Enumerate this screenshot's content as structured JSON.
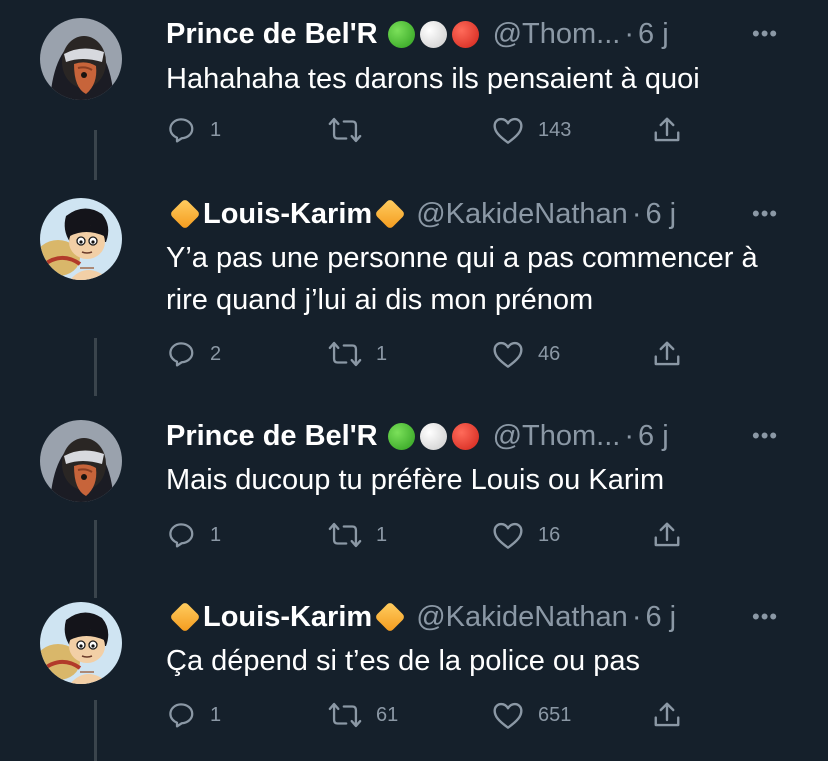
{
  "colors": {
    "background": "#15202b",
    "thread_line": "#3a444c",
    "secondary_text": "#8b98a5",
    "primary_text": "#ffffff"
  },
  "tweets": [
    {
      "author": "Prince de Bel'R",
      "name_decor": [
        "green-circle",
        "white-circle",
        "red-circle"
      ],
      "handle": "@Thom...",
      "time": "6 j",
      "text": "Hahahaha tes darons ils pensaient à quoi",
      "replies": "1",
      "retweets": "",
      "likes": "143",
      "avatar": "dark-hooded-character-avatar"
    },
    {
      "author": "Louis-Karim",
      "name_decor": [
        "orange-diamond",
        "orange-diamond"
      ],
      "handle": "@KakideNathan",
      "time": "6 j",
      "text": "Y’a pas une personne qui a pas commencer à rire quand j’lui ai dis mon prénom",
      "replies": "2",
      "retweets": "1",
      "likes": "46",
      "avatar": "straw-hat-character-avatar"
    },
    {
      "author": "Prince de Bel'R",
      "name_decor": [
        "green-circle",
        "white-circle",
        "red-circle"
      ],
      "handle": "@Thom...",
      "time": "6 j",
      "text": "Mais ducoup tu préfère Louis ou Karim",
      "replies": "1",
      "retweets": "1",
      "likes": "16",
      "avatar": "dark-hooded-character-avatar"
    },
    {
      "author": "Louis-Karim",
      "name_decor": [
        "orange-diamond",
        "orange-diamond"
      ],
      "handle": "@KakideNathan",
      "time": "6 j",
      "text": "Ça dépend si t’es de la police ou pas",
      "replies": "1",
      "retweets": "61",
      "likes": "651",
      "avatar": "straw-hat-character-avatar"
    }
  ],
  "ui": {
    "separator": "·",
    "more_label": "•••"
  }
}
